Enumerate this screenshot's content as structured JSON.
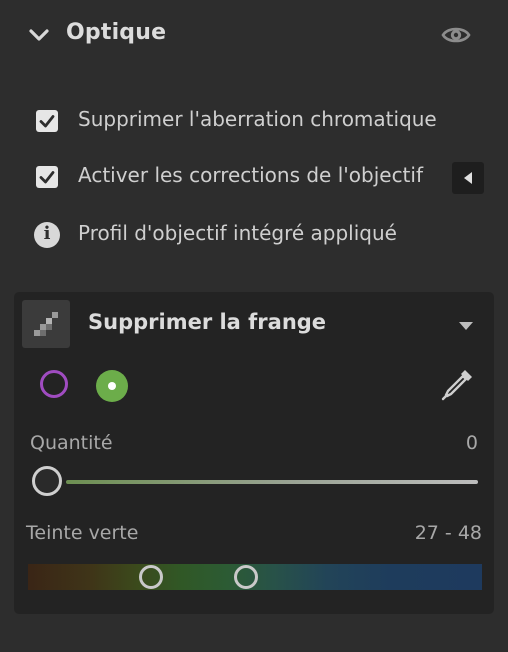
{
  "section": {
    "title": "Optique"
  },
  "options": [
    {
      "label": "Supprimer l'aberration chromatique",
      "checked": true
    },
    {
      "label": "Activer les corrections de l'objectif",
      "checked": true
    }
  ],
  "profile_info": "Profil d'objectif intégré appliqué",
  "fringe": {
    "title": "Supprimer la frange",
    "amount": {
      "label": "Quantité",
      "value": "0"
    },
    "green_hue": {
      "label": "Teinte verte",
      "value": "27 - 48",
      "low": 27,
      "high": 48
    }
  },
  "colors": {
    "purple_swatch": "#a04cc1",
    "green_swatch": "#6cad4a"
  }
}
